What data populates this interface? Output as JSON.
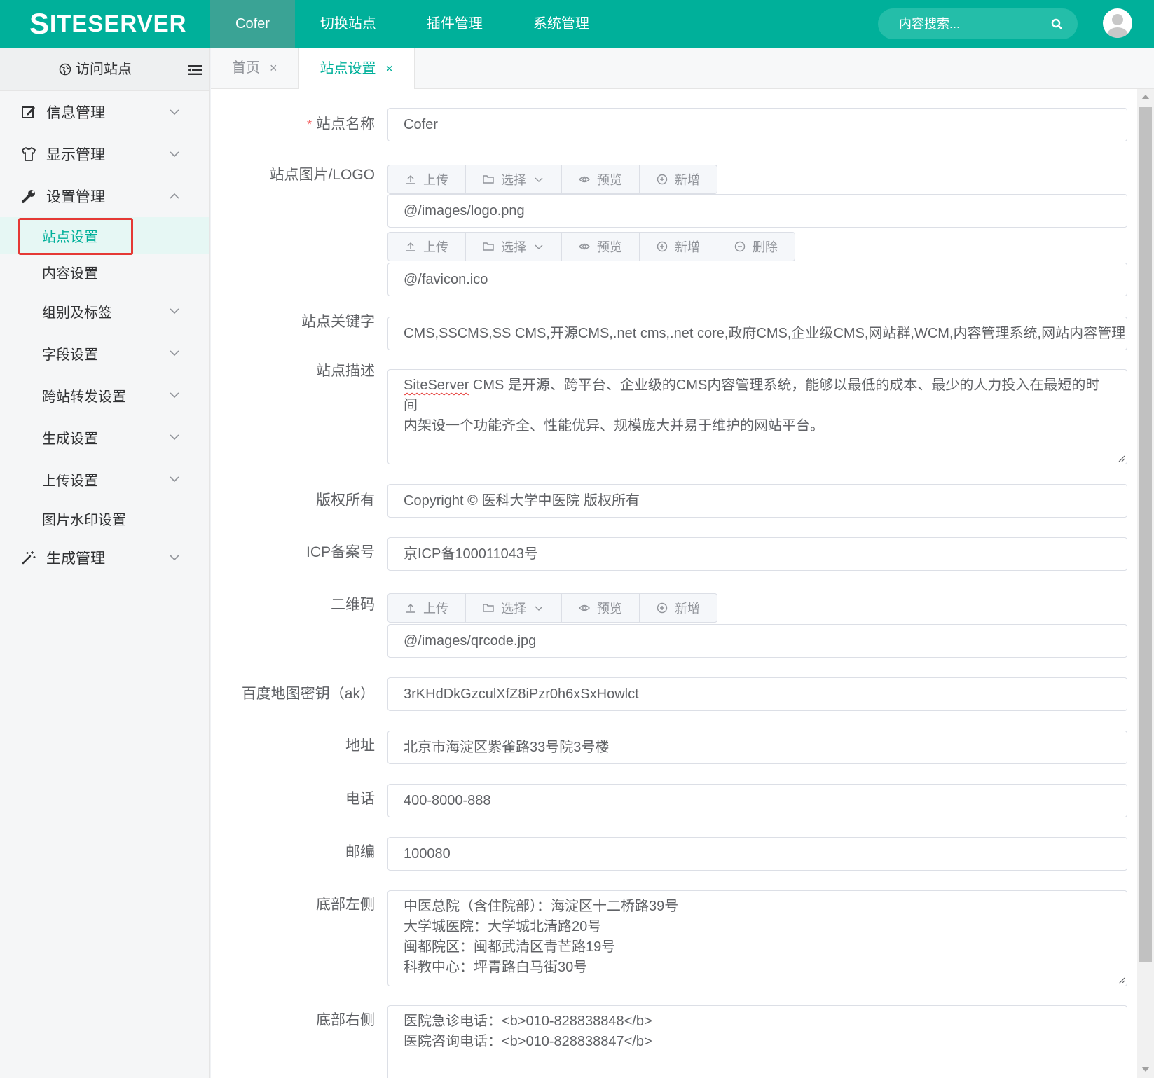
{
  "header": {
    "logo_initial": "S",
    "logo_rest": "ITESERVER",
    "nav": [
      {
        "label": "Cofer"
      },
      {
        "label": "切换站点"
      },
      {
        "label": "插件管理"
      },
      {
        "label": "系统管理"
      }
    ],
    "search_placeholder": "内容搜索..."
  },
  "sidebar": {
    "visit_label": "访问站点",
    "menu": [
      {
        "label": "信息管理"
      },
      {
        "label": "显示管理"
      },
      {
        "label": "设置管理"
      }
    ],
    "sub": [
      {
        "label": "站点设置"
      },
      {
        "label": "内容设置"
      },
      {
        "label": "组别及标签"
      },
      {
        "label": "字段设置"
      },
      {
        "label": "跨站转发设置"
      },
      {
        "label": "生成设置"
      },
      {
        "label": "上传设置"
      },
      {
        "label": "图片水印设置"
      }
    ],
    "generate": {
      "label": "生成管理"
    }
  },
  "tabs": [
    {
      "label": "首页",
      "close": "×"
    },
    {
      "label": "站点设置",
      "close": "×"
    }
  ],
  "buttons": {
    "upload": "上传",
    "select": "选择",
    "preview": "预览",
    "add": "新增",
    "delete": "删除"
  },
  "form": {
    "site_name": {
      "label": "站点名称",
      "required_mark": "*",
      "value": "Cofer"
    },
    "logo": {
      "label": "站点图片/LOGO",
      "value1": "@/images/logo.png",
      "value2": "@/favicon.ico"
    },
    "keywords": {
      "label": "站点关键字",
      "value": "CMS,SSCMS,SS CMS,开源CMS,.net cms,.net core,政府CMS,企业级CMS,网站群,WCM,内容管理系统,网站内容管理,"
    },
    "description": {
      "label": "站点描述",
      "value_word": "SiteServer",
      "value_rest": " CMS 是开源、跨平台、企业级的CMS内容管理系统，能够以最低的成本、最少的人力投入在最短的时间",
      "value_line2": "内架设一个功能齐全、性能优异、规模庞大并易于维护的网站平台。"
    },
    "copyright": {
      "label": "版权所有",
      "value": "Copyright © 医科大学中医院  版权所有"
    },
    "icp": {
      "label": "ICP备案号",
      "value": "京ICP备100011043号"
    },
    "qrcode": {
      "label": "二维码",
      "value": "@/images/qrcode.jpg"
    },
    "baidu_ak": {
      "label": "百度地图密钥（ak）",
      "value": "3rKHdDkGzculXfZ8iPzr0h6xSxHowlct"
    },
    "address": {
      "label": "地址",
      "value": "北京市海淀区紫雀路33号院3号楼"
    },
    "phone": {
      "label": "电话",
      "value": "400-8000-888"
    },
    "zipcode": {
      "label": "邮编",
      "value": "100080"
    },
    "footer_left": {
      "label": "底部左侧",
      "lines": [
        "中医总院（含住院部）：海淀区十二桥路39号",
        "大学城医院：大学城北清路20号",
        "闽都院区：闽都武清区青芒路19号",
        "科教中心：坪青路白马街30号"
      ]
    },
    "footer_right": {
      "label": "底部右侧",
      "lines": [
        "医院急诊电话：<b>010-828838848</b>",
        "医院咨询电话：<b>010-828838847</b>"
      ]
    }
  },
  "colors": {
    "brand": "#00b09a",
    "active_nav": "#3aa395",
    "highlight": "#e53935"
  }
}
